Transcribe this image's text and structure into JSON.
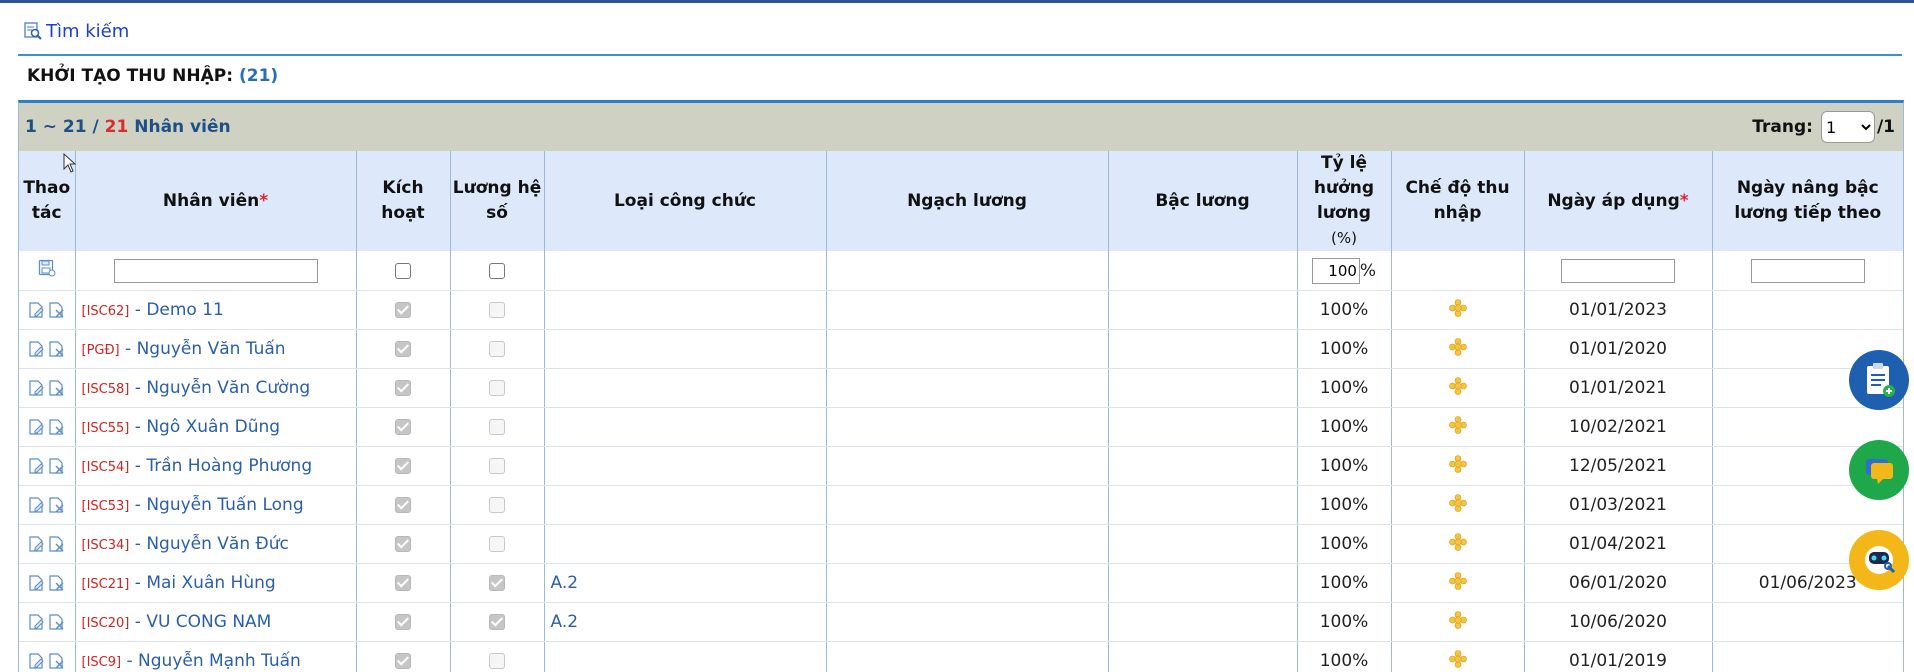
{
  "search": {
    "label": "Tìm kiếm"
  },
  "page": {
    "title": "KHỞI TẠO THU NHẬP:",
    "count": "(21)"
  },
  "pager": {
    "range": "1 ~ 21",
    "sep": "/",
    "total": "21",
    "unit": "Nhân viên",
    "page_label": "Trang:",
    "page_value": "1",
    "page_total": "/1"
  },
  "columns": {
    "action": "Thao tác",
    "employee": "Nhân viên",
    "active": "Kích hoạt",
    "coef": "Lương hệ số",
    "civil_type": "Loại công chức",
    "salary_scale": "Ngạch lương",
    "salary_level": "Bậc lương",
    "rate": "Tỷ lệ hưởng lương",
    "rate_unit": "(%)",
    "income_mode": "Chế độ thu nhập",
    "apply_date": "Ngày áp dụng",
    "next_raise": "Ngày nâng bậc lương tiếp theo",
    "required_mark": "*"
  },
  "filter": {
    "rate_value": "100",
    "rate_suffix": "%"
  },
  "rows": [
    {
      "code": "[ISC62]",
      "name": "Demo 11",
      "active": true,
      "coef": false,
      "civil_type": "",
      "rate": "100%",
      "apply_date": "01/01/2023",
      "next_raise": ""
    },
    {
      "code": "[PGĐ]",
      "name": "Nguyễn Văn Tuấn",
      "active": true,
      "coef": false,
      "civil_type": "",
      "rate": "100%",
      "apply_date": "01/01/2020",
      "next_raise": ""
    },
    {
      "code": "[ISC58]",
      "name": "Nguyễn Văn Cường",
      "active": true,
      "coef": false,
      "civil_type": "",
      "rate": "100%",
      "apply_date": "01/01/2021",
      "next_raise": ""
    },
    {
      "code": "[ISC55]",
      "name": "Ngô Xuân Dũng",
      "active": true,
      "coef": false,
      "civil_type": "",
      "rate": "100%",
      "apply_date": "10/02/2021",
      "next_raise": ""
    },
    {
      "code": "[ISC54]",
      "name": "Trần Hoàng Phương",
      "active": true,
      "coef": false,
      "civil_type": "",
      "rate": "100%",
      "apply_date": "12/05/2021",
      "next_raise": ""
    },
    {
      "code": "[ISC53]",
      "name": "Nguyễn Tuấn Long",
      "active": true,
      "coef": false,
      "civil_type": "",
      "rate": "100%",
      "apply_date": "01/03/2021",
      "next_raise": ""
    },
    {
      "code": "[ISC34]",
      "name": "Nguyễn Văn Đức",
      "active": true,
      "coef": false,
      "civil_type": "",
      "rate": "100%",
      "apply_date": "01/04/2021",
      "next_raise": ""
    },
    {
      "code": "[ISC21]",
      "name": "Mai Xuân Hùng",
      "active": true,
      "coef": true,
      "civil_type": "A.2",
      "rate": "100%",
      "apply_date": "06/01/2020",
      "next_raise": "01/06/2023"
    },
    {
      "code": "[ISC20]",
      "name": "VU CONG NAM",
      "active": true,
      "coef": true,
      "civil_type": "A.2",
      "rate": "100%",
      "apply_date": "10/06/2020",
      "next_raise": ""
    },
    {
      "code": "[ISC9]",
      "name": "Nguyễn Mạnh Tuấn",
      "active": true,
      "coef": false,
      "civil_type": "",
      "rate": "100%",
      "apply_date": "01/01/2019",
      "next_raise": ""
    }
  ],
  "colors": {
    "accent": "#2e7fc8",
    "header_bg": "#dde9fa",
    "pager_bg": "#cfd1c3",
    "required": "#e0282e",
    "link": "#2a5fa7"
  }
}
